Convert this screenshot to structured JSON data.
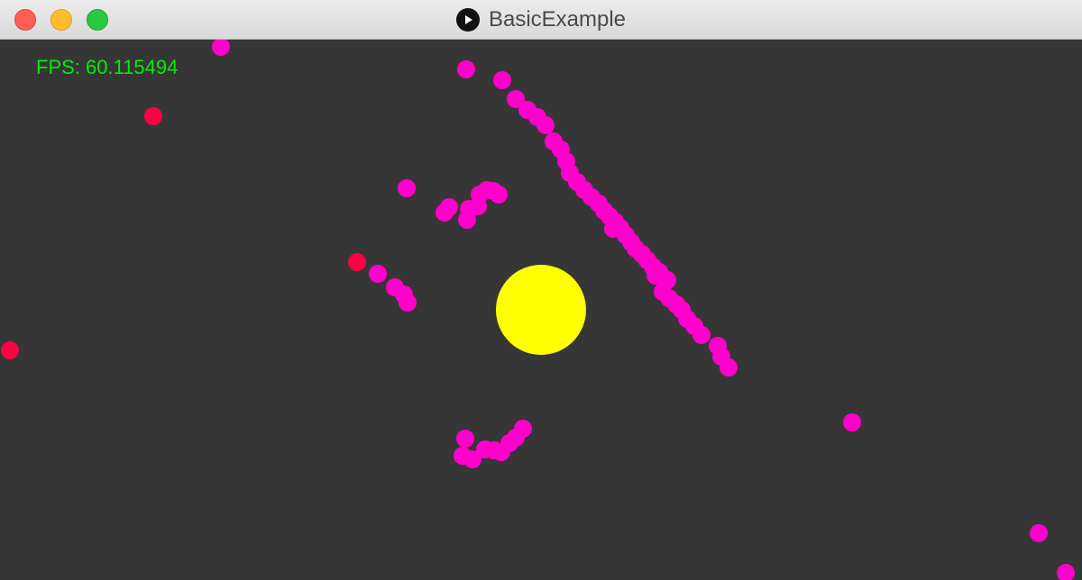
{
  "window": {
    "title": "BasicExample",
    "app_icon": "play-icon"
  },
  "hud": {
    "fps_text": "FPS: 60.115494"
  },
  "colors": {
    "background": "#363636",
    "attractor": "#ffff00",
    "particle": "#ff00cc",
    "particle_alt": "#ff0044",
    "fps_text": "#00ee00"
  }
}
